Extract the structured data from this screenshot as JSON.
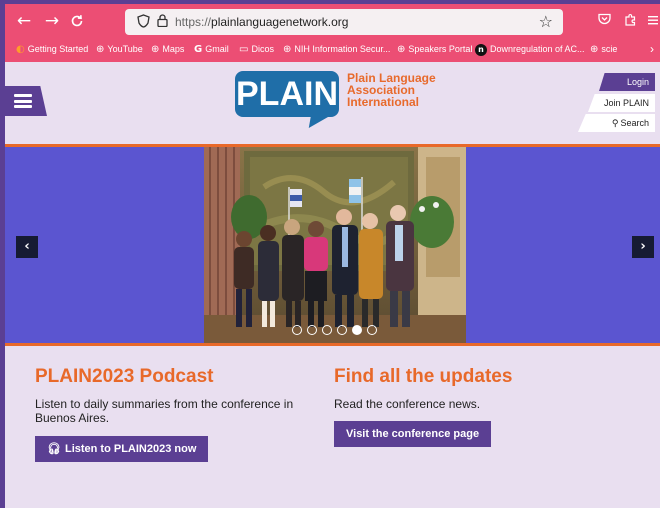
{
  "browser": {
    "url_host": "plainlanguagenetwork.org",
    "url_prefix": "https://",
    "nav": {
      "back": "←",
      "forward": "→",
      "reload": "C"
    },
    "icons": [
      "shield-icon",
      "lock-icon",
      "star-icon",
      "pocket-icon",
      "extensions-icon",
      "menu-icon"
    ],
    "bookmarks": [
      {
        "label": "Getting Started",
        "icon": "firefox-icon"
      },
      {
        "label": "YouTube",
        "icon": "globe-icon"
      },
      {
        "label": "Maps",
        "icon": "globe-icon"
      },
      {
        "label": "Gmail",
        "icon": "google-icon"
      },
      {
        "label": "Dicos",
        "icon": "folder-icon"
      },
      {
        "label": "NIH Information Secur...",
        "icon": "globe-icon"
      },
      {
        "label": "Speakers Portal",
        "icon": "globe-icon"
      },
      {
        "label": "Downregulation of AC...",
        "icon": "n-icon"
      },
      {
        "label": "scie",
        "icon": "globe-icon"
      }
    ],
    "more_bookmarks": "›"
  },
  "header": {
    "logo_text": "PLAIN",
    "org_line1": "Plain Language",
    "org_line2": "Association",
    "org_line3": "International",
    "login": "Login",
    "join": "Join PLAIN",
    "search": "Search"
  },
  "carousel": {
    "prev": "‹",
    "next": "›",
    "slide_count": 6,
    "active_slide": 5
  },
  "promos": {
    "left": {
      "title": "PLAIN2023 Podcast",
      "text": "Listen to daily summaries from the conference in Buenos Aires.",
      "button": "Listen to PLAIN2023 now"
    },
    "right": {
      "title": "Find all the updates",
      "text": "Read the conference news.",
      "button": "Visit the conference page"
    }
  },
  "colors": {
    "purple": "#5b3f93",
    "orange": "#e8692a",
    "logo_blue": "#1f6ea8",
    "browser_pink": "#ec4e74",
    "carousel_blue": "#5b55d0"
  }
}
